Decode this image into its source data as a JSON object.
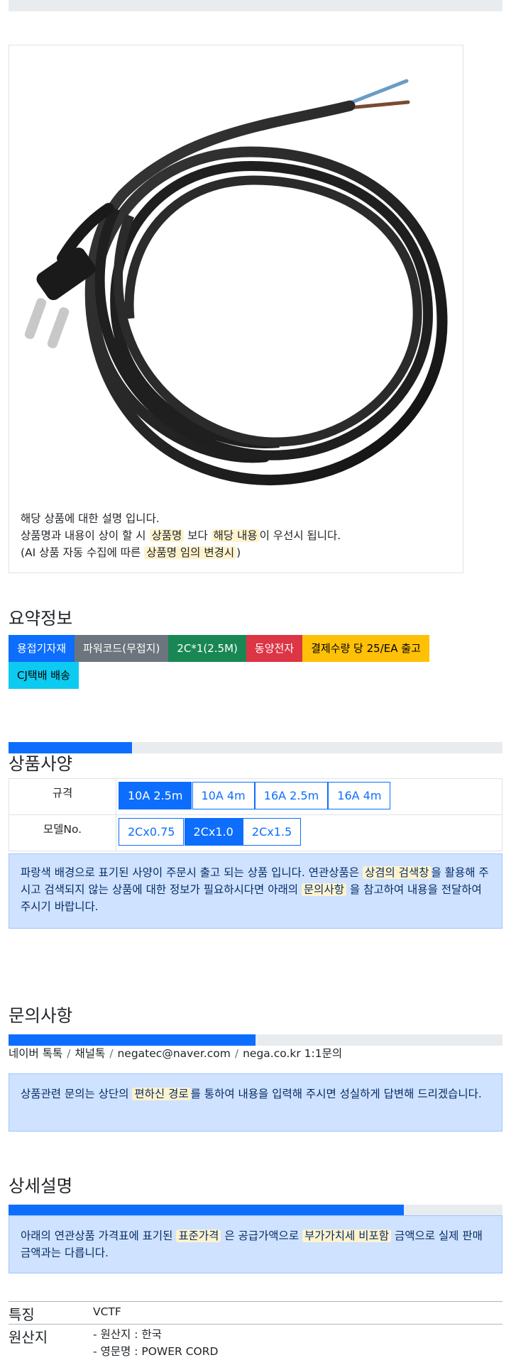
{
  "product": {
    "image_alt": "black power cord with plug",
    "notice_line1": "해당 상품에 대한 설명 입니다.",
    "notice_line2_a": "상품명과 내용이 상이 할 시 ",
    "notice_line2_hl1": "상품명",
    "notice_line2_b": " 보다 ",
    "notice_line2_hl2": "해당 내용",
    "notice_line2_c": "이 우선시 됩니다.",
    "notice_line3_a": "(AI 상품 자동 수집에 따른 ",
    "notice_line3_hl": "상품명 임의 변경시",
    "notice_line3_b": ")"
  },
  "summary": {
    "title": "요약정보",
    "badges": [
      "용접기자재",
      "파워코드(무접지)",
      "2C*1(2.5M)",
      "동양전자",
      "결제수량 당 25/EA 출고",
      "CJ택배 배송"
    ]
  },
  "spec": {
    "title": "상품사양",
    "progress": 0.25,
    "rows": [
      {
        "label": "규격",
        "options": [
          "10A 2.5m",
          "10A 4m",
          "16A 2.5m",
          "16A 4m"
        ],
        "selected": 0
      },
      {
        "label": "모델No.",
        "options": [
          "2Cx0.75",
          "2Cx1.0",
          "2Cx1.5"
        ],
        "selected": 1
      }
    ],
    "alert_a": "파랑색 배경으로 표기된 사양이 주문시 출고 되는 상품 입니다. 연관상품은 ",
    "alert_hl1": "상겸의 검색창",
    "alert_b": "을 활용해 주시고 검색되지 않는 상품에 대한 정보가 필요하시다면 아래의 ",
    "alert_hl2": "문의사항",
    "alert_c": " 을 참고하여 내용을 전달하여 주시기 바랍니다."
  },
  "inquiry": {
    "title": "문의사항",
    "progress": 0.5,
    "contacts": [
      "네이버 톡톡",
      "채널톡",
      "negatec@naver.com",
      "nega.co.kr 1:1문의"
    ],
    "separator": "/",
    "alert_a": "상품관련 문의는 상단의 ",
    "alert_hl": "편하신 경로",
    "alert_b": "를 통하여 내용을 입력해 주시면 성실하게 답변해 드리겠습니다."
  },
  "detail": {
    "title": "상세설명",
    "progress": 0.8,
    "alert_a": "아래의 연관상품 가격표에 표기된 ",
    "alert_hl1": "표준가격",
    "alert_b": " 은 공급가액으로 ",
    "alert_hl2": "부가가치세 비포함",
    "alert_c": " 금액으로 실제 판매금액과는 다릅니다.",
    "rows": [
      {
        "key": "특징",
        "lines": [
          "VCTF"
        ]
      },
      {
        "key": "원산지",
        "lines": [
          "- 원산지 : 한국",
          "- 영문명 : POWER CORD"
        ]
      }
    ]
  },
  "colors": {
    "primary": "#0d6efd",
    "alert_bg": "#cfe2ff",
    "highlight": "#fff3cd"
  }
}
